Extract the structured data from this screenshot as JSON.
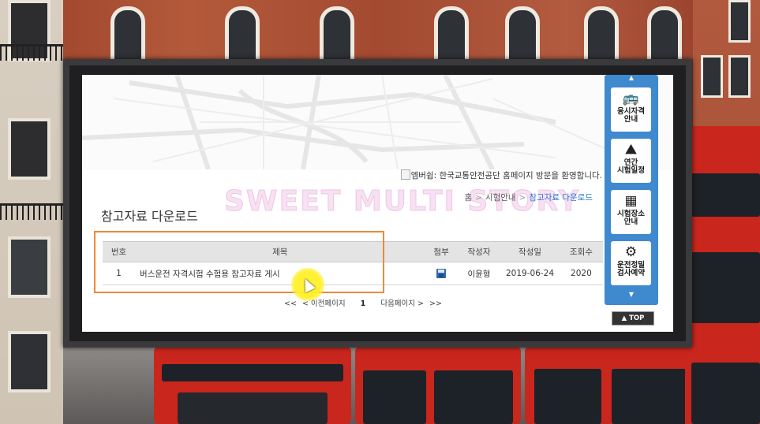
{
  "header": {
    "welcome_alt": "엠버쉽",
    "welcome_text": ": 한국교통안전공단 홈페이지 방문을 환영합니다.",
    "watermark": "SWEET MULTI STORY"
  },
  "breadcrumb": {
    "home": "홈",
    "parent": "시험안내",
    "current": "참고자료 다운로드",
    "separator": ">"
  },
  "page": {
    "title": "참고자료 다운로드"
  },
  "table": {
    "headers": {
      "num": "번호",
      "title": "제목",
      "attachment": "첨부",
      "author": "작성자",
      "date": "작성일",
      "views": "조회수"
    },
    "rows": [
      {
        "num": "1",
        "title": "버스운전 자격시험 수험용 참고자료 게시",
        "author": "이윤형",
        "date": "2019-06-24",
        "views": "2020",
        "attachment_icon": "floppy-disk-icon"
      }
    ]
  },
  "pagination": {
    "first": "<<",
    "prev": "< 이전페이지",
    "current": "1",
    "next": "다음페이지 >",
    "last": ">>"
  },
  "quick_menu": {
    "up_arrow": "▲",
    "down_arrow": "▼",
    "items": [
      {
        "label_1": "응시자격",
        "label_2": "안내",
        "icon": "bus-icon"
      },
      {
        "label_1": "연간",
        "label_2": "시험일정",
        "icon": "road-icon"
      },
      {
        "label_1": "시험장소",
        "label_2": "안내",
        "icon": "building-icon"
      },
      {
        "label_1": "운전정밀",
        "label_2": "검사예약",
        "icon": "gear-icon"
      }
    ],
    "top_button": "▲ TOP"
  },
  "colors": {
    "accent": "#3f89cf",
    "highlight_box": "#ee8a3a",
    "link_current": "#2a7ad0"
  }
}
